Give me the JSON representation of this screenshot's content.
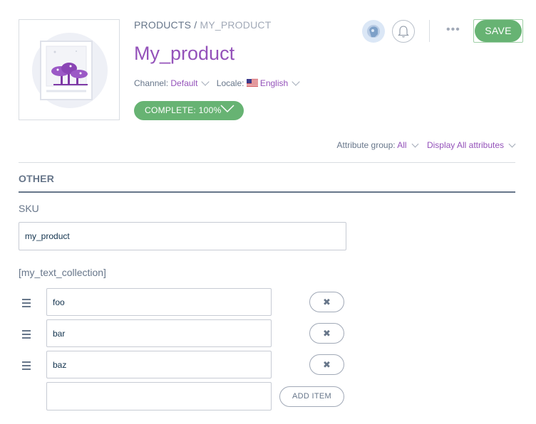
{
  "breadcrumb": {
    "root": "PRODUCTS",
    "separator": "/",
    "current": "MY_PRODUCT"
  },
  "product": {
    "title": "My_product"
  },
  "context": {
    "channel_label": "Channel:",
    "channel_value": "Default",
    "locale_label": "Locale:",
    "locale_value": "English",
    "locale_flag_icon": "us-flag-icon"
  },
  "completeness": {
    "label": "COMPLETE: 100%",
    "percent": 100
  },
  "header": {
    "save_label": "SAVE",
    "more_label": "•••"
  },
  "filters": {
    "attribute_group_label": "Attribute group:",
    "attribute_group_value": "All",
    "display_label": "Display All attributes"
  },
  "section": {
    "title": "OTHER"
  },
  "sku": {
    "label": "SKU",
    "value": "my_product"
  },
  "collection": {
    "label": "[my_text_collection]",
    "items": [
      {
        "value": "foo"
      },
      {
        "value": "bar"
      },
      {
        "value": "baz"
      }
    ],
    "new_item_value": "",
    "remove_label": "✖",
    "add_label": "ADD ITEM"
  },
  "colors": {
    "accent": "#9452ba",
    "success": "#67b373",
    "text": "#67768a",
    "border": "#c7cbd4"
  }
}
